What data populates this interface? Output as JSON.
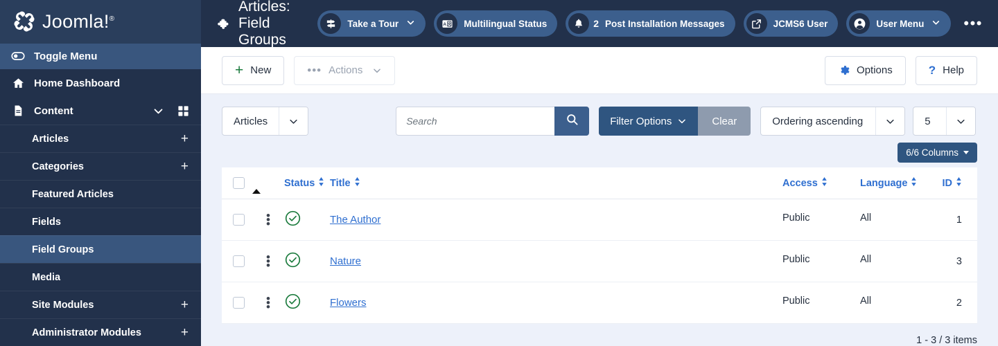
{
  "brand": {
    "name": "Joomla!",
    "trademark": "®"
  },
  "sidebar": {
    "toggle_label": "Toggle Menu",
    "items": [
      {
        "label": "Home Dashboard",
        "icon": "home-icon",
        "level": 1,
        "expandable": false,
        "active": false
      },
      {
        "label": "Content",
        "icon": "document-icon",
        "level": 1,
        "expandable": true,
        "active": false
      }
    ],
    "sub_items": [
      {
        "label": "Articles",
        "plus": "+",
        "active": false
      },
      {
        "label": "Categories",
        "plus": "+",
        "active": false
      },
      {
        "label": "Featured Articles",
        "plus": "",
        "active": false
      },
      {
        "label": "Fields",
        "plus": "",
        "active": false
      },
      {
        "label": "Field Groups",
        "plus": "",
        "active": true
      },
      {
        "label": "Media",
        "plus": "",
        "active": false
      },
      {
        "label": "Site Modules",
        "plus": "+",
        "active": false
      },
      {
        "label": "Administrator Modules",
        "plus": "+",
        "active": false
      }
    ]
  },
  "topbar": {
    "title": "Articles: Field Groups",
    "title_icon": "puzzle-piece-icon",
    "pills": [
      {
        "label": "Take a Tour",
        "icon": "signpost-icon",
        "chevron": true,
        "badge": ""
      },
      {
        "label": "Multilingual Status",
        "icon": "translate-icon",
        "chevron": false,
        "badge": ""
      },
      {
        "label": "Post Installation Messages",
        "icon": "bell-icon",
        "chevron": false,
        "badge": "2"
      },
      {
        "label": "JCMS6 User",
        "icon": "external-link-icon",
        "chevron": false,
        "badge": ""
      },
      {
        "label": "User Menu",
        "icon": "user-circle-icon",
        "chevron": true,
        "badge": ""
      }
    ],
    "overflow_label": "•••"
  },
  "toolbar": {
    "new_label": "New",
    "actions_label": "Actions",
    "options_label": "Options",
    "help_label": "Help"
  },
  "filters": {
    "scope_label": "Articles",
    "search_placeholder": "Search",
    "search_value": "",
    "filter_options_label": "Filter Options",
    "clear_label": "Clear",
    "ordering_label": "Ordering ascending",
    "limit_label": "5",
    "columns_badge": "6/6 Columns"
  },
  "table": {
    "headers": {
      "status": "Status",
      "title": "Title",
      "access": "Access",
      "language": "Language",
      "id": "ID"
    },
    "rows": [
      {
        "status": "published",
        "title": "The Author",
        "access": "Public",
        "language": "All",
        "id": "1"
      },
      {
        "status": "published",
        "title": "Nature",
        "access": "Public",
        "language": "All",
        "id": "3"
      },
      {
        "status": "published",
        "title": "Flowers",
        "access": "Public",
        "language": "All",
        "id": "2"
      }
    ]
  },
  "footer": {
    "count_text": "1 - 3 / 3 items"
  },
  "colors": {
    "sidebar_bg": "#22314b",
    "sidebar_active": "#39567e",
    "accent_blue": "#2f6fd0",
    "filter_blue": "#2f5580",
    "clear_grey": "#8e9bae",
    "status_green": "#1a7a3c",
    "page_bg": "#edf1fa"
  }
}
